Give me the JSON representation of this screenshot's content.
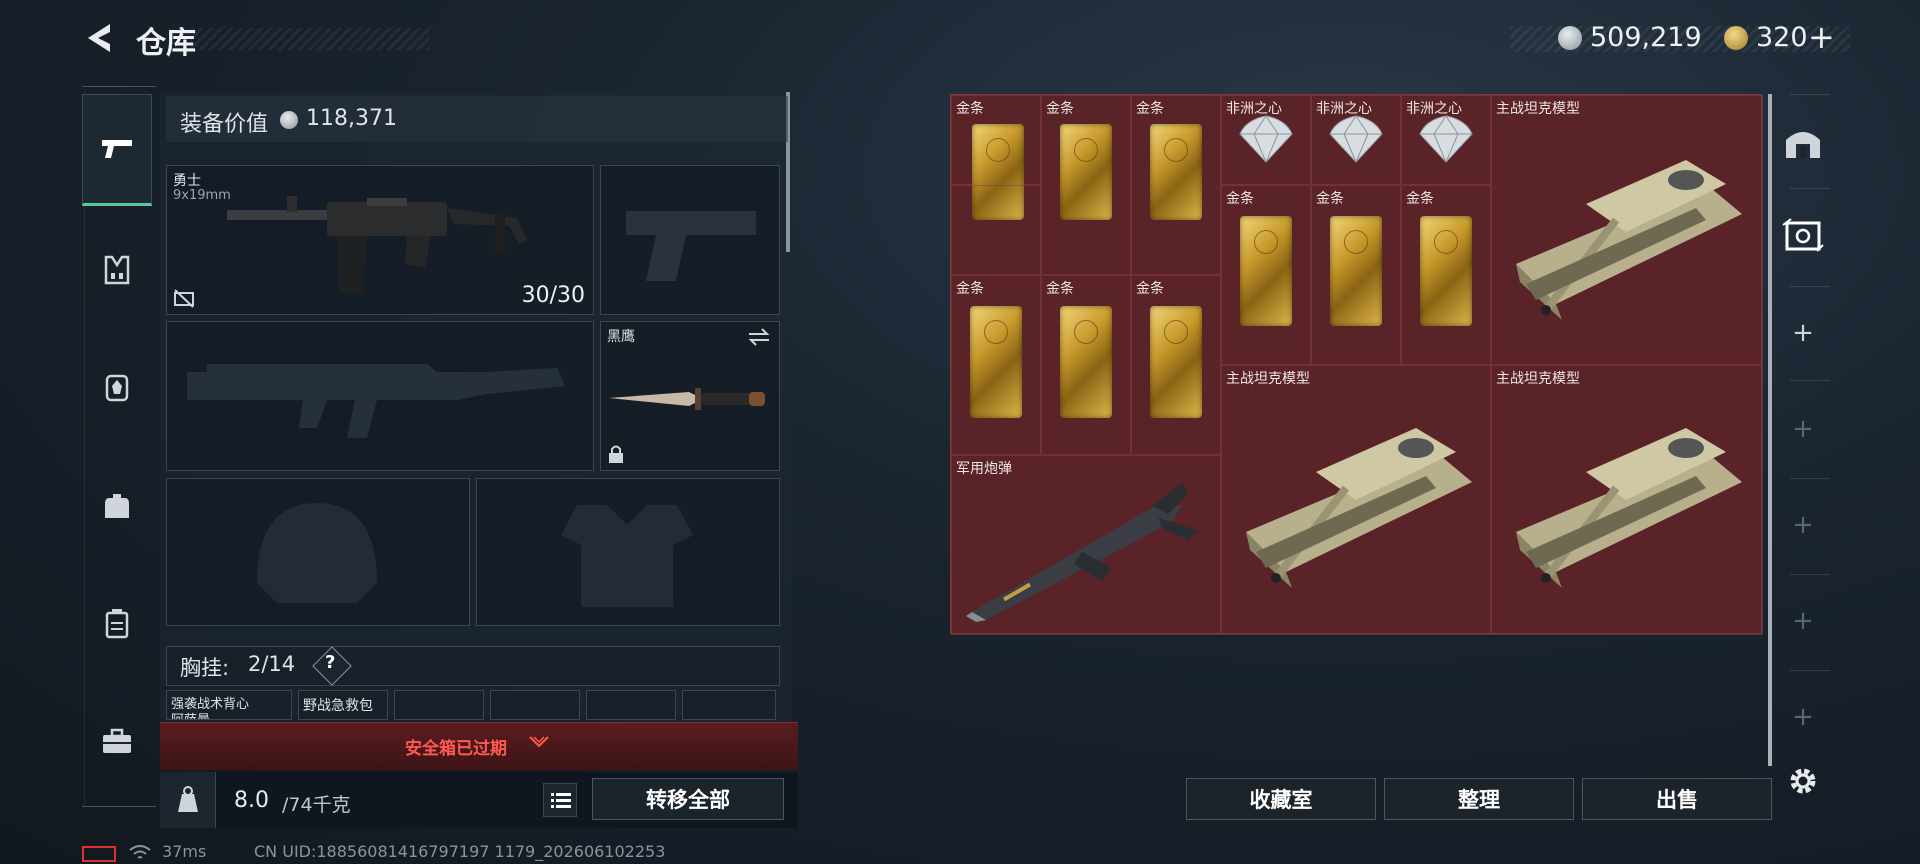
{
  "header": {
    "title": "仓库",
    "currency_silver": "509,219",
    "currency_gold": "320",
    "add_label": "+"
  },
  "nav": {
    "items": [
      "pistol-icon",
      "armor-vest-icon",
      "backpack-alt-icon",
      "backpack-icon",
      "case-icon",
      "toolbox-icon"
    ]
  },
  "loadout": {
    "gear_value_label": "装备价值",
    "gear_value": "118,371",
    "primary": {
      "name": "勇士",
      "caliber": "9x19mm",
      "ammo": "30/30"
    },
    "melee": {
      "name": "黑鹰"
    },
    "chest_label": "胸挂:",
    "chest_count": "2/14",
    "help": "?",
    "chest_slots": [
      "强袭战术背心",
      "野战急救包"
    ],
    "chest_slot_sub": "阿萨曼",
    "expired_text": "安全箱已过期",
    "weight_value": "8.0",
    "weight_max": "/74千克",
    "transfer_all": "转移全部"
  },
  "stash": {
    "items": [
      {
        "label": "金条",
        "type": "gold"
      },
      {
        "label": "非洲之心",
        "type": "diamond"
      },
      {
        "label": "主战坦克模型",
        "type": "tank"
      },
      {
        "label": "军用炮弹",
        "type": "missile"
      }
    ]
  },
  "actions": {
    "collection": "收藏室",
    "organize": "整理",
    "sell": "出售"
  },
  "status": {
    "ping": "37ms",
    "uid": "CN UID:18856081416797197 1179_202606102253"
  },
  "colors": {
    "accent_green": "#58c8a0",
    "stash_bg": "#5a2327",
    "expired_red": "#ff5a52"
  }
}
